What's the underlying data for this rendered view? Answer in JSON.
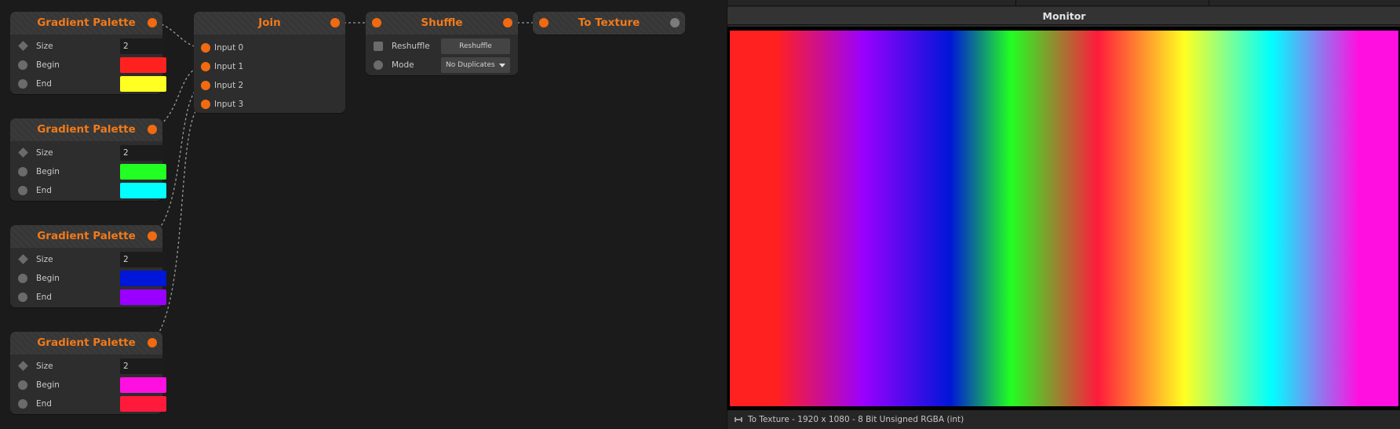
{
  "gradient_nodes": [
    {
      "title": "Gradient Palette",
      "size_label": "Size",
      "size_value": "2",
      "begin_label": "Begin",
      "end_label": "End",
      "begin_color": "#ff2020",
      "end_color": "#ffff22"
    },
    {
      "title": "Gradient Palette",
      "size_label": "Size",
      "size_value": "2",
      "begin_label": "Begin",
      "end_label": "End",
      "begin_color": "#22ff22",
      "end_color": "#00ffff"
    },
    {
      "title": "Gradient Palette",
      "size_label": "Size",
      "size_value": "2",
      "begin_label": "Begin",
      "end_label": "End",
      "begin_color": "#0016d8",
      "end_color": "#9a00ff"
    },
    {
      "title": "Gradient Palette",
      "size_label": "Size",
      "size_value": "2",
      "begin_label": "Begin",
      "end_label": "End",
      "begin_color": "#ff10e0",
      "end_color": "#ff1a3c"
    }
  ],
  "join_node": {
    "title": "Join",
    "inputs": [
      "Input 0",
      "Input 1",
      "Input 2",
      "Input 3"
    ]
  },
  "shuffle_node": {
    "title": "Shuffle",
    "reshuffle_label": "Reshuffle",
    "reshuffle_button": "Reshuffle",
    "mode_label": "Mode",
    "mode_value": "No Duplicates"
  },
  "to_texture_node": {
    "title": "To Texture"
  },
  "monitor": {
    "title": "Monitor",
    "status": "To Texture - 1920 x 1080 - 8 Bit Unsigned RGBA (int)",
    "status_icon": "texture-icon",
    "gradient_stops": [
      "#ff2020",
      "#9a00ff",
      "#0016d8",
      "#22ff22",
      "#ff1a3c",
      "#ffff22",
      "#00ffff",
      "#ff10e0"
    ]
  },
  "colors": {
    "accent": "#f07a1a",
    "port": "#f26a10",
    "background": "#1b1b1b",
    "node": "#2d2d2d"
  }
}
